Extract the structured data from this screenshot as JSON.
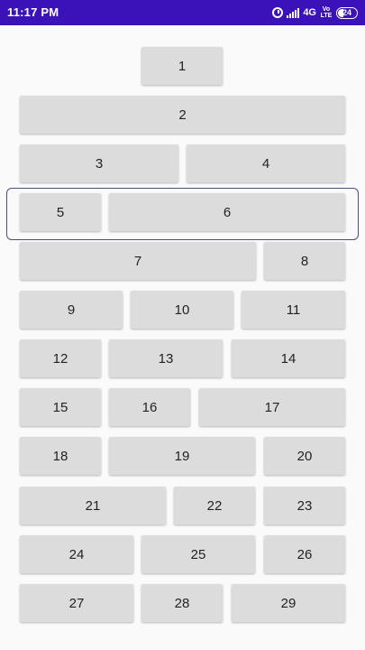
{
  "status_bar": {
    "time": "11:17 PM",
    "network": "4G",
    "volte": "Vo LTE",
    "battery": "24"
  },
  "buttons": {
    "b1": "1",
    "b2": "2",
    "b3": "3",
    "b4": "4",
    "b5": "5",
    "b6": "6",
    "b7": "7",
    "b8": "8",
    "b9": "9",
    "b10": "10",
    "b11": "11",
    "b12": "12",
    "b13": "13",
    "b14": "14",
    "b15": "15",
    "b16": "16",
    "b17": "17",
    "b18": "18",
    "b19": "19",
    "b20": "20",
    "b21": "21",
    "b22": "22",
    "b23": "23",
    "b24": "24",
    "b25": "25",
    "b26": "26",
    "b27": "27",
    "b28": "28",
    "b29": "29"
  }
}
